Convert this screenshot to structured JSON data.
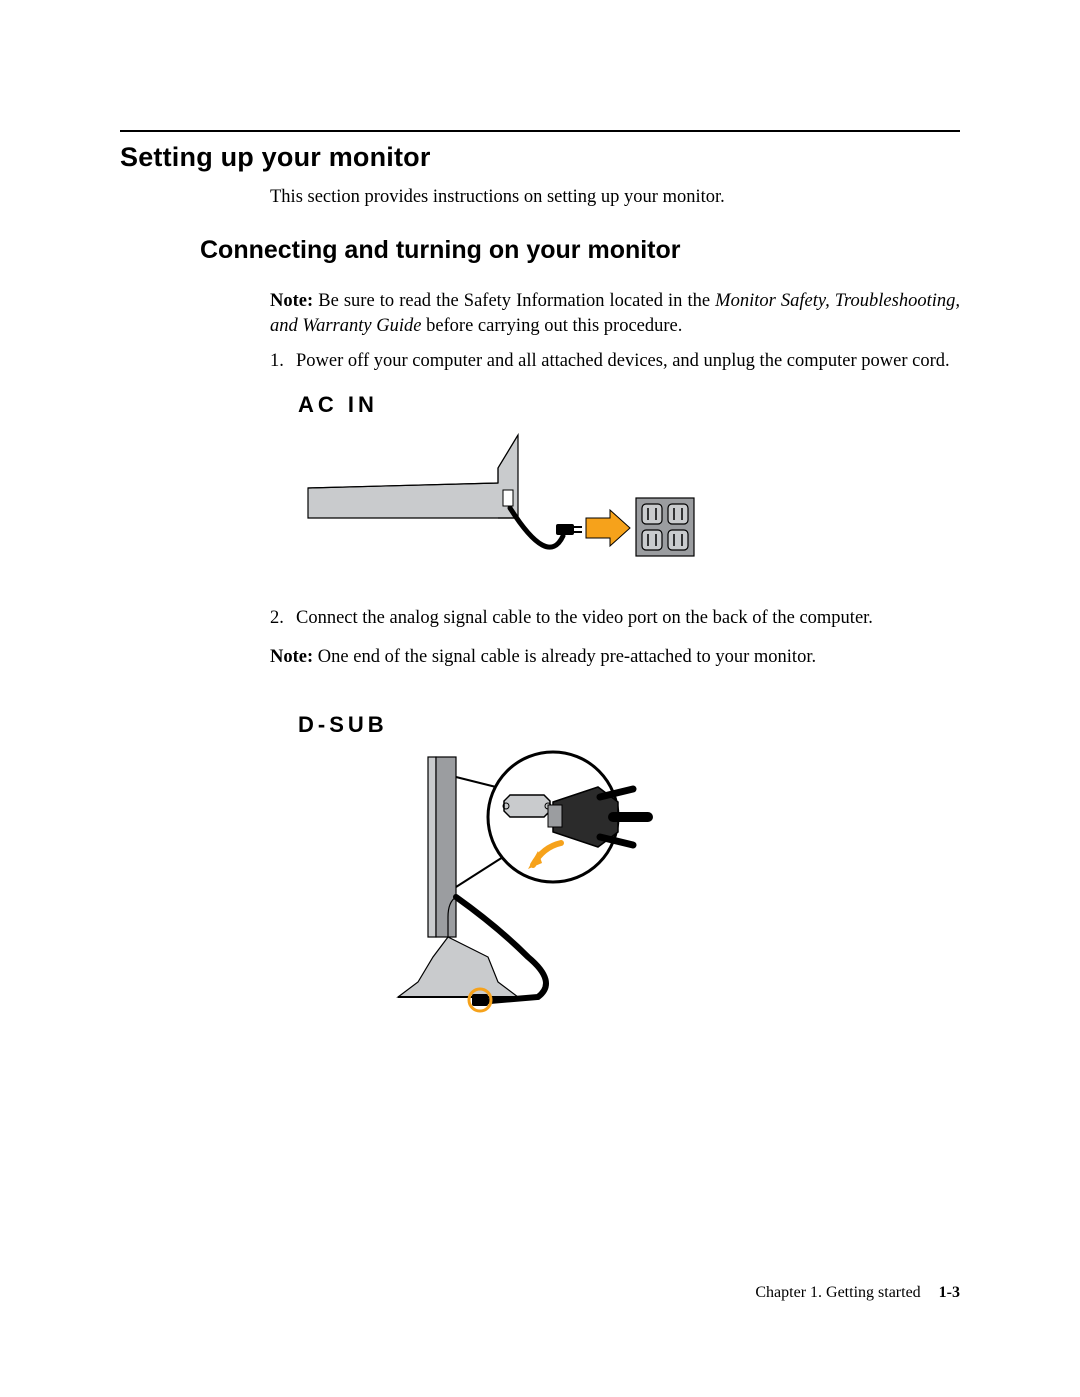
{
  "heading1": "Setting up your monitor",
  "intro": "This section provides instructions on setting up your monitor.",
  "heading2": "Connecting and turning on your monitor",
  "note1_lead": "Note:",
  "note1_a": " Be sure to read the Safety Information located in the ",
  "note1_ital": "Monitor Safety, Troubleshooting, and Warranty Guide",
  "note1_b": " before carrying out this procedure.",
  "step1_num": "1.",
  "step1_text": "Power off your computer and all attached devices, and unplug the computer power cord.",
  "fig1_label": "AC IN",
  "step2_num": "2.",
  "step2_text": "Connect the analog signal cable to the video port on the back of the computer.",
  "note2_lead": "Note:",
  "note2_text": " One end of the signal cable is already pre-attached to your monitor.",
  "fig2_label": "D-SUB",
  "footer_chapter": "Chapter 1. Getting started",
  "footer_page": "1-3"
}
